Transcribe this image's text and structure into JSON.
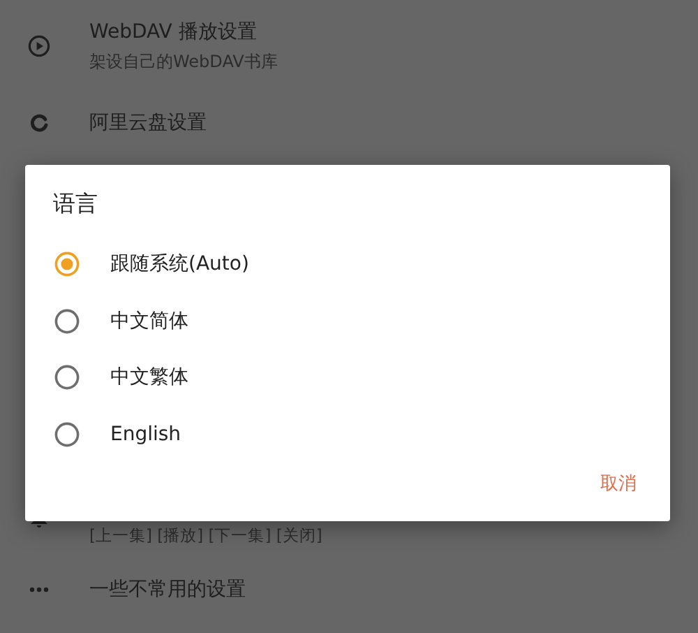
{
  "settings": [
    {
      "title": "WebDAV 播放设置",
      "subtitle": "架设自己的WebDAV书库"
    },
    {
      "title": "阿里云盘设置"
    },
    {
      "subtitle": "[上一集] [播放] [下一集] [关闭]"
    },
    {
      "title": "一些不常用的设置"
    }
  ],
  "dialog": {
    "title": "语言",
    "options": [
      {
        "label": "跟随系统(Auto)",
        "selected": true
      },
      {
        "label": "中文简体",
        "selected": false
      },
      {
        "label": "中文繁体",
        "selected": false
      },
      {
        "label": "English",
        "selected": false
      }
    ],
    "cancel": "取消"
  }
}
